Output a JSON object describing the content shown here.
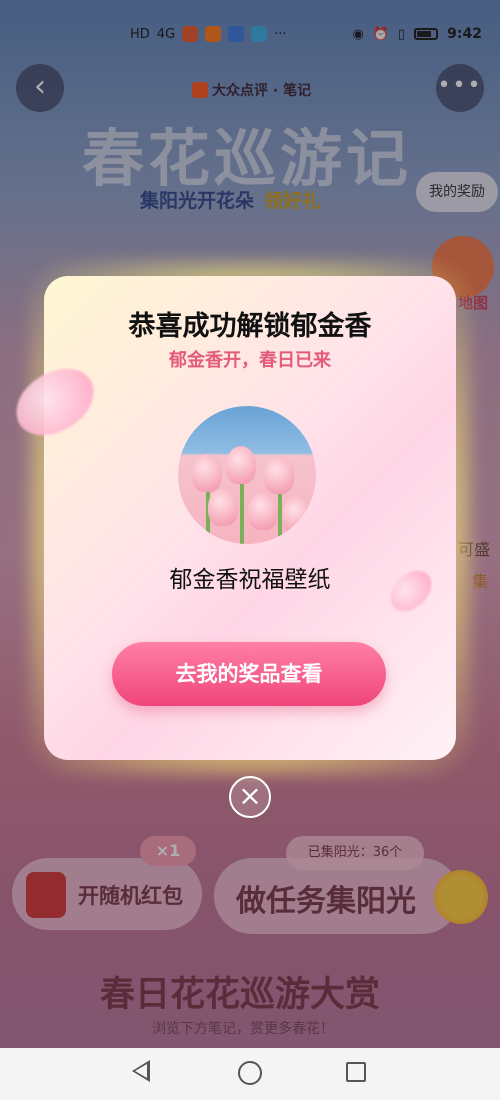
{
  "status_bar": {
    "network_label": "HD",
    "signal_label": "4G",
    "time": "9:42",
    "more": "···"
  },
  "header": {
    "brand": "大众点评 · 笔记",
    "hero_title": "春花巡游记",
    "hero_sub": "集阳光开花朵",
    "hero_sub_gold": "领好礼",
    "my_reward": "我的奖励",
    "map_label": "地图",
    "side_text": "可盛",
    "side_text2": "集"
  },
  "actions": {
    "red_packet_label": "开随机红包",
    "red_packet_badge": "×1",
    "task_label": "做任务集阳光",
    "collected": "已集阳光：36个"
  },
  "section": {
    "title": "春日花花巡游大赏",
    "subtitle": "浏览下方笔记，赏更多春花！"
  },
  "modal": {
    "title": "恭喜成功解锁郁金香",
    "subtitle": "郁金香开，春日已来",
    "prize_name": "郁金香祝福壁纸",
    "cta_label": "去我的奖品查看",
    "close_symbol": "×"
  },
  "icons": {
    "back": "chevron-left-icon",
    "more": "more-dots-icon",
    "close": "close-icon",
    "sun": "sun-icon",
    "red_envelope": "red-envelope-icon"
  },
  "colors": {
    "cta_pink": "#f0457b",
    "subtitle_pink": "#e35a7a",
    "glow_yellow": "#fff096"
  }
}
